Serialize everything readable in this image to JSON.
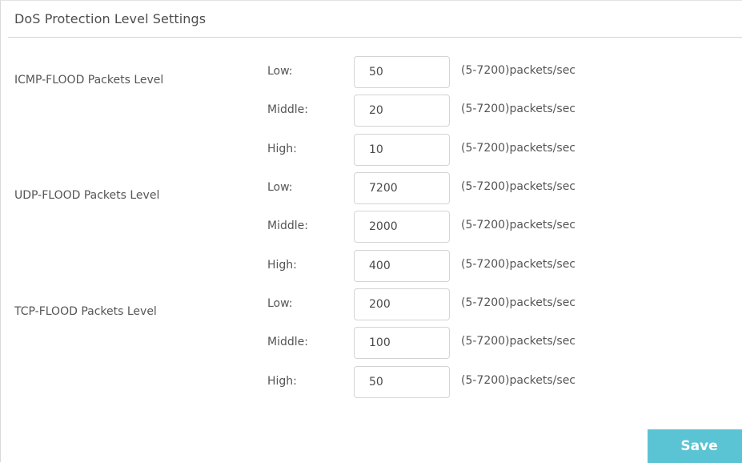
{
  "section": {
    "title": "DoS Protection Level Settings"
  },
  "groups": [
    {
      "label": "ICMP-FLOOD Packets Level",
      "levels": [
        {
          "label": "Low:",
          "value": "50",
          "hint": "(5-7200)packets/sec"
        },
        {
          "label": "Middle:",
          "value": "20",
          "hint": "(5-7200)packets/sec"
        },
        {
          "label": "High:",
          "value": "10",
          "hint": "(5-7200)packets/sec"
        }
      ]
    },
    {
      "label": "UDP-FLOOD Packets Level",
      "levels": [
        {
          "label": "Low:",
          "value": "7200",
          "hint": "(5-7200)packets/sec"
        },
        {
          "label": "Middle:",
          "value": "2000",
          "hint": "(5-7200)packets/sec"
        },
        {
          "label": "High:",
          "value": "400",
          "hint": "(5-7200)packets/sec"
        }
      ]
    },
    {
      "label": "TCP-FLOOD Packets Level",
      "levels": [
        {
          "label": "Low:",
          "value": "200",
          "hint": "(5-7200)packets/sec"
        },
        {
          "label": "Middle:",
          "value": "100",
          "hint": "(5-7200)packets/sec"
        },
        {
          "label": "High:",
          "value": "50",
          "hint": "(5-7200)packets/sec"
        }
      ]
    }
  ],
  "actions": {
    "save_label": "Save"
  },
  "colors": {
    "accent": "#5bc4d4",
    "text": "#555555",
    "border": "#d4d4d4"
  }
}
